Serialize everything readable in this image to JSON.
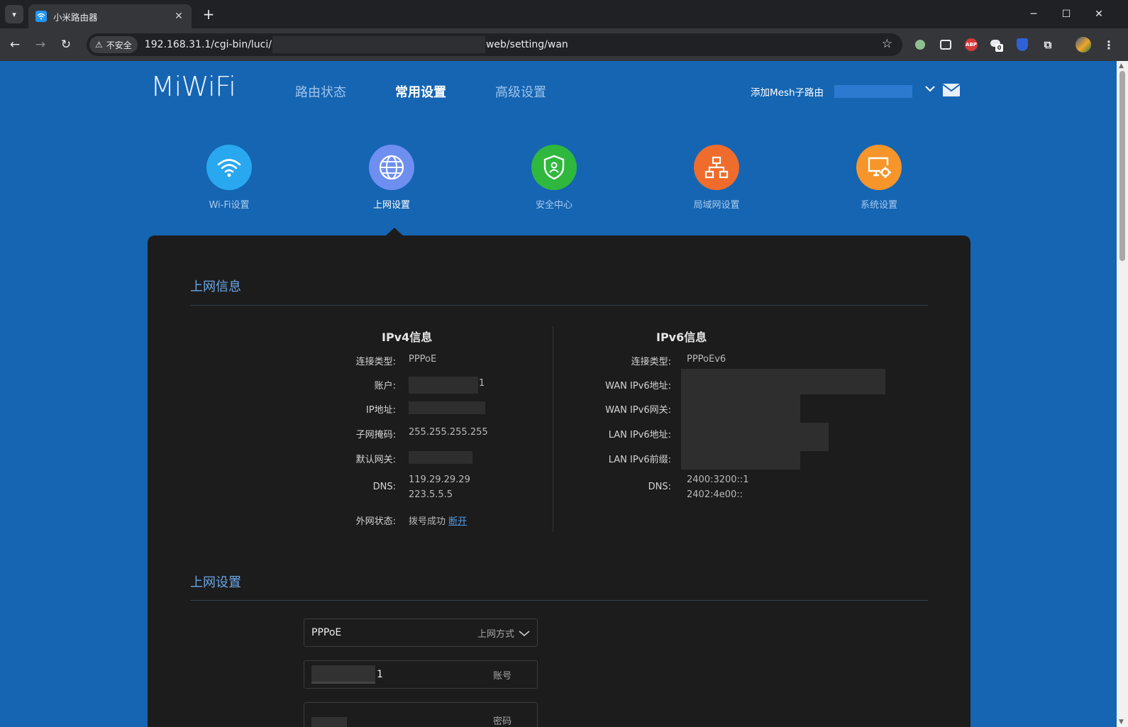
{
  "browser": {
    "tab_title": "小米路由器",
    "tab_close": "✕",
    "new_tab": "+",
    "security_label": "不安全",
    "url_prefix": "192.168.31.1/cgi-bin/luci/",
    "url_suffix": "web/setting/wan",
    "extensions": [
      "ABP",
      "0"
    ]
  },
  "header": {
    "logo": "MiWiFi",
    "nav": [
      "路由状态",
      "常用设置",
      "高级设置"
    ],
    "active_nav": "常用设置",
    "mesh_label": "添加Mesh子路由"
  },
  "categories": [
    {
      "label": "Wi-Fi设置",
      "color": "#29a8f0",
      "icon": "wifi-icon"
    },
    {
      "label": "上网设置",
      "color": "#6e8ff0",
      "icon": "globe-icon"
    },
    {
      "label": "安全中心",
      "color": "#2fb83d",
      "icon": "shield-icon"
    },
    {
      "label": "局域网设置",
      "color": "#ef6c2c",
      "icon": "network-icon"
    },
    {
      "label": "系统设置",
      "color": "#f5952a",
      "icon": "settings-monitor-icon"
    }
  ],
  "active_category": "上网设置",
  "wan_info": {
    "title": "上网信息",
    "ipv4": {
      "title": "IPv4信息",
      "conn_type_label": "连接类型:",
      "conn_type": "PPPoE",
      "account_label": "账户:",
      "account_suffix": "1",
      "ip_label": "IP地址:",
      "mask_label": "子网掩码:",
      "mask": "255.255.255.255",
      "gateway_label": "默认网关:",
      "dns_label": "DNS:",
      "dns1": "119.29.29.29",
      "dns2": "223.5.5.5",
      "status_label": "外网状态:",
      "status": "拨号成功",
      "disconnect": "断开"
    },
    "ipv6": {
      "title": "IPv6信息",
      "conn_type_label": "连接类型:",
      "conn_type": "PPPoEv6",
      "wan_addr_label": "WAN IPv6地址:",
      "wan_gw_label": "WAN IPv6网关:",
      "lan_addr_label": "LAN IPv6地址:",
      "lan_prefix_label": "LAN IPv6前缀:",
      "dns_label": "DNS:",
      "dns1": "2400:3200::1",
      "dns2": "2402:4e00::"
    }
  },
  "wan_settings": {
    "title": "上网设置",
    "mode_value": "PPPoE",
    "mode_hint": "上网方式",
    "account_suffix": "1",
    "account_hint": "账号",
    "password_hint": "密码"
  }
}
